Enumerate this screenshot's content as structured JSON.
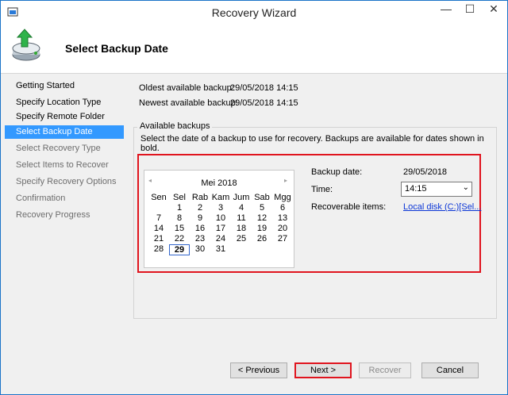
{
  "window": {
    "title": "Recovery Wizard",
    "minimize_glyph": "—",
    "maximize_glyph": "☐",
    "close_glyph": "✕"
  },
  "header": {
    "title": "Select Backup Date"
  },
  "sidebar": {
    "items": [
      {
        "label": "Getting Started",
        "state": "normal"
      },
      {
        "label": "Specify Location Type",
        "state": "normal"
      },
      {
        "label": "Specify Remote Folder",
        "state": "normal"
      },
      {
        "label": "Select Backup Date",
        "state": "selected"
      },
      {
        "label": "Select Recovery Type",
        "state": "disabled"
      },
      {
        "label": "Select Items to Recover",
        "state": "disabled"
      },
      {
        "label": "Specify Recovery Options",
        "state": "disabled"
      },
      {
        "label": "Confirmation",
        "state": "disabled"
      },
      {
        "label": "Recovery Progress",
        "state": "disabled"
      }
    ]
  },
  "info": {
    "oldest_label": "Oldest available backup:",
    "oldest_value": "29/05/2018 14:15",
    "newest_label": "Newest available backup:",
    "newest_value": "29/05/2018 14:15"
  },
  "backups": {
    "legend": "Available backups",
    "description": "Select the date of a backup to use for recovery. Backups are available for dates shown in bold."
  },
  "calendar": {
    "prev_glyph": "◂",
    "next_glyph": "▸",
    "month": "Mei 2018",
    "weekdays": [
      "Sen",
      "Sel",
      "Rab",
      "Kam",
      "Jum",
      "Sab",
      "Mgg"
    ],
    "weeks": [
      [
        "",
        "1",
        "2",
        "3",
        "4",
        "5",
        "6"
      ],
      [
        "7",
        "8",
        "9",
        "10",
        "11",
        "12",
        "13"
      ],
      [
        "14",
        "15",
        "16",
        "17",
        "18",
        "19",
        "20"
      ],
      [
        "21",
        "22",
        "23",
        "24",
        "25",
        "26",
        "27"
      ],
      [
        "28",
        "29",
        "30",
        "31",
        "",
        "",
        ""
      ]
    ],
    "bold_date": "29"
  },
  "details": {
    "backup_date_label": "Backup date:",
    "backup_date_value": "29/05/2018",
    "time_label": "Time:",
    "time_value": "14:15",
    "time_arrow": "⌄",
    "items_label": "Recoverable items:",
    "items_link": "Local disk (C:)[Sel..."
  },
  "buttons": {
    "previous": "< Previous",
    "next": "Next >",
    "recover": "Recover",
    "cancel": "Cancel"
  }
}
